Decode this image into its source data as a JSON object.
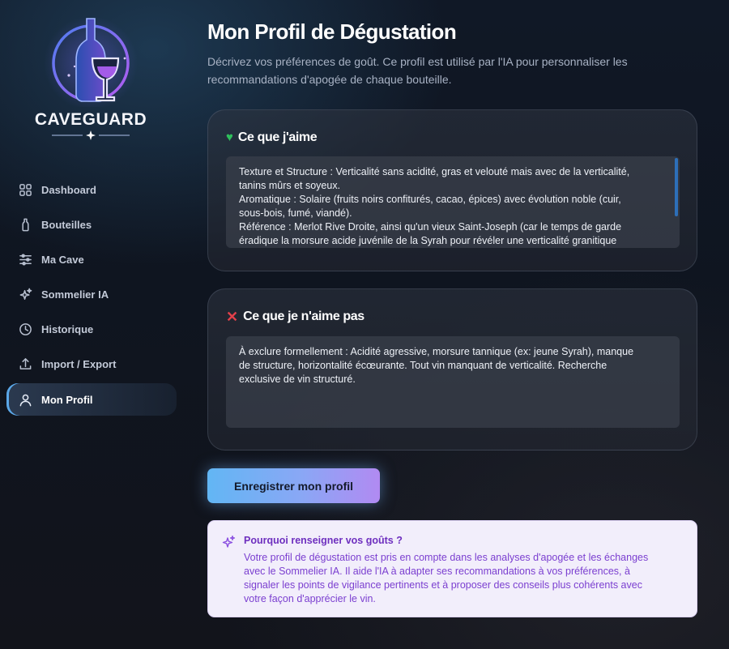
{
  "brand": {
    "name": "CAVEGUARD",
    "logo_icon": "wine-bottle-glass-icon",
    "colors": {
      "accent_blue": "#5aa7e8",
      "accent_purple": "#b18af2",
      "like": "#2fbf5c",
      "dislike": "#e2404a"
    }
  },
  "sidebar": {
    "items": [
      {
        "label": "Dashboard",
        "icon": "grid-icon",
        "active": false
      },
      {
        "label": "Bouteilles",
        "icon": "bottle-icon",
        "active": false
      },
      {
        "label": "Ma Cave",
        "icon": "sliders-icon",
        "active": false
      },
      {
        "label": "Sommelier IA",
        "icon": "sparkles-icon",
        "active": false
      },
      {
        "label": "Historique",
        "icon": "clock-icon",
        "active": false
      },
      {
        "label": "Import / Export",
        "icon": "upload-icon",
        "active": false
      },
      {
        "label": "Mon Profil",
        "icon": "user-icon",
        "active": true
      }
    ]
  },
  "page": {
    "title": "Mon Profil de Dégustation",
    "subtitle": "Décrivez vos préférences de goût. Ce profil est utilisé par l'IA pour personnaliser les recommandations d'apogée de chaque bouteille."
  },
  "likes": {
    "label": "Ce que j'aime",
    "icon": "heart-icon",
    "lines": [
      "Texture et Structure : Verticalité sans acidité, gras et velouté mais avec de la verticalité,",
      "tanins mûrs et soyeux.",
      "Aromatique : Solaire (fruits noirs confiturés, cacao, épices) avec évolution noble (cuir,",
      "sous-bois, fumé, viandé).",
      "Référence : Merlot Rive Droite, ainsi qu'un vieux Saint-Joseph (car le temps de garde",
      "éradique la morsure acide juvénile de la Syrah pour révéler une verticalité granitique"
    ]
  },
  "dislikes": {
    "label": "Ce que je n'aime pas",
    "icon": "cross-icon",
    "lines": [
      "À exclure formellement : Acidité agressive, morsure tannique (ex: jeune Syrah), manque",
      "de structure, horizontalité écœurante. Tout vin manquant de verticalité. Recherche",
      "exclusive de vin structuré."
    ]
  },
  "save_button": {
    "label": "Enregistrer mon profil"
  },
  "info": {
    "icon": "sparkles-icon",
    "title": "Pourquoi renseigner vos goûts ?",
    "lines": [
      "Votre profil de dégustation est pris en compte dans les analyses d'apogée et les échanges",
      "avec le Sommelier IA. Il aide l'IA à adapter ses recommandations à vos préférences, à",
      "signaler les points de vigilance pertinents et à proposer des conseils plus cohérents avec",
      "votre façon d'apprécier le vin."
    ]
  }
}
